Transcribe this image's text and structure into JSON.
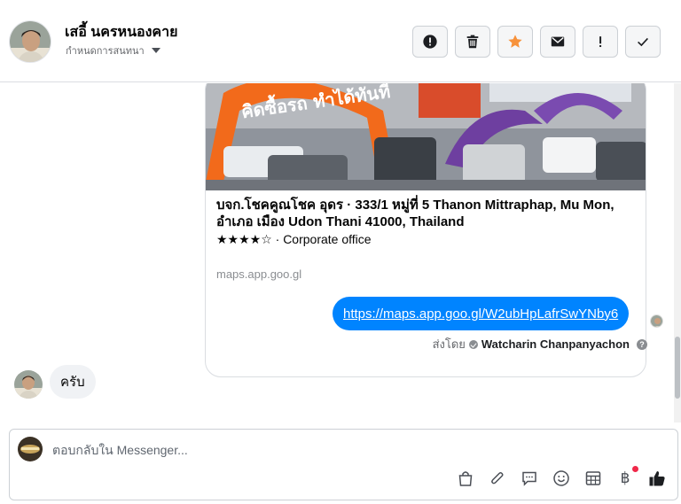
{
  "header": {
    "contact_name": "เสอี้ นครหนองคาย",
    "conversation_settings": "กำหนดการสนทนา",
    "toolbar": [
      {
        "name": "report-spam-button",
        "icon": "alert-circle-icon"
      },
      {
        "name": "delete-button",
        "icon": "trash-icon"
      },
      {
        "name": "star-button",
        "icon": "star-icon"
      },
      {
        "name": "mark-unread-button",
        "icon": "envelope-icon"
      },
      {
        "name": "follow-up-button",
        "icon": "exclamation-icon"
      },
      {
        "name": "mark-done-button",
        "icon": "check-icon"
      }
    ]
  },
  "thread": {
    "link_card": {
      "title": "บจก.โชคคูณโชค อุดร · 333/1 หมู่ที่ 5 Thanon Mittraphap, Mu Mon, อำเภอ เมือง Udon Thani 41000, Thailand",
      "rating": "★★★★☆ · Corporate office",
      "domain": "maps.app.goo.gl",
      "image_text": "คิดซื้อรถ ทำได้ทันที"
    },
    "outgoing_message": "https://maps.app.goo.gl/W2ubHpLafrSwYNby6",
    "sent_by_prefix": "ส่งโดย",
    "sent_by_name": "Watcharin Chanpanyachon",
    "help": "?",
    "incoming_message": "ครับ"
  },
  "composer": {
    "placeholder": "ตอบกลับใน Messenger...",
    "tools": [
      "bag-icon",
      "paperclip-icon",
      "chat-bubble-icon",
      "emoji-icon",
      "table-icon",
      "baht-icon",
      "thumbs-up-icon"
    ],
    "baht_symbol": "฿"
  },
  "colors": {
    "accent": "#0084ff",
    "star": "#f7923b",
    "border": "#dadde1",
    "incoming_bubble": "#f0f2f5"
  }
}
